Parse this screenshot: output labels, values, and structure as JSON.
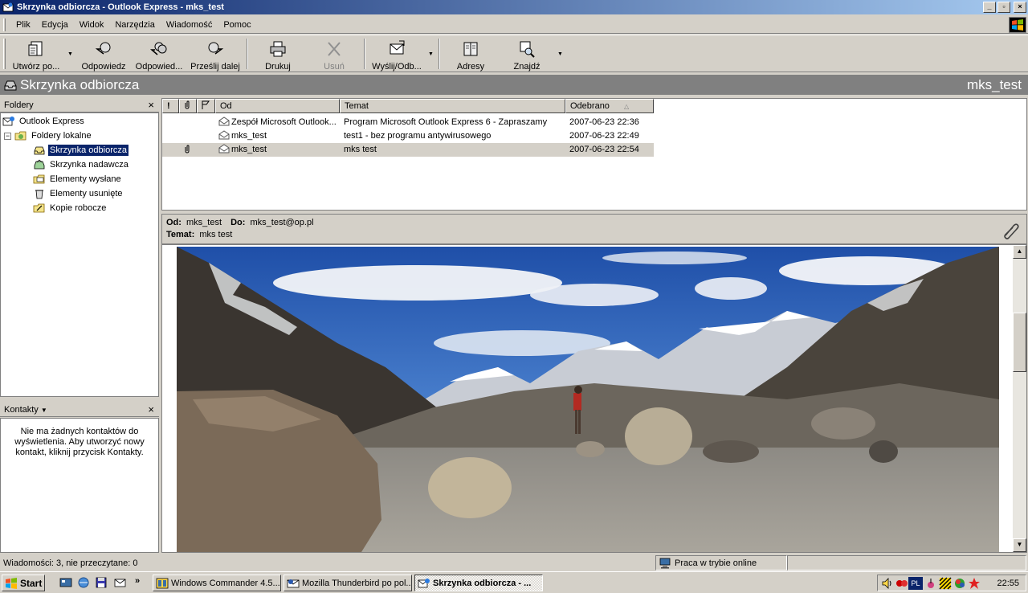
{
  "window": {
    "title": "Skrzynka odbiorcza - Outlook Express - mks_test",
    "minimize_glyph": "_",
    "maximize_glyph": "▫",
    "close_glyph": "×"
  },
  "menu": [
    "Plik",
    "Edycja",
    "Widok",
    "Narzędzia",
    "Wiadomość",
    "Pomoc"
  ],
  "toolbar": {
    "create": "Utwórz po...",
    "reply": "Odpowiedz",
    "reply_all": "Odpowied...",
    "forward": "Prześlij dalej",
    "print": "Drukuj",
    "delete": "Usuń",
    "send_receive": "Wyślij/Odb...",
    "addresses": "Adresy",
    "find": "Znajdź",
    "dropdown_glyph": "▼"
  },
  "folder_bar": {
    "title": "Skrzynka odbiorcza",
    "user": "mks_test"
  },
  "folders": {
    "header": "Foldery",
    "close_glyph": "×",
    "expander": "−",
    "tree": [
      {
        "label": "Outlook Express",
        "icon": "outlook-express-icon"
      },
      {
        "label": "Foldery lokalne",
        "icon": "local-folders-icon"
      },
      {
        "label": "Skrzynka odbiorcza",
        "icon": "inbox-icon"
      },
      {
        "label": "Skrzynka nadawcza",
        "icon": "outbox-icon"
      },
      {
        "label": "Elementy wysłane",
        "icon": "sent-items-icon"
      },
      {
        "label": "Elementy usunięte",
        "icon": "deleted-items-icon"
      },
      {
        "label": "Kopie robocze",
        "icon": "drafts-icon"
      }
    ]
  },
  "contacts": {
    "header": "Kontakty",
    "dropdown_glyph": "▼",
    "close_glyph": "×",
    "message": "Nie ma żadnych kontaktów do wyświetlenia. Aby utworzyć nowy kontakt, kliknij przycisk Kontakty."
  },
  "message_list": {
    "columns": {
      "priority": "!",
      "attachment": "",
      "flag": "",
      "from": "Od",
      "subject": "Temat",
      "received": "Odebrano",
      "sort_glyph": "△"
    },
    "messages": [
      {
        "from": "Zespół Microsoft Outlook...",
        "subject": "Program Microsoft Outlook Express 6 - Zapraszamy",
        "received": "2007-06-23 22:36",
        "attachment": false
      },
      {
        "from": "mks_test",
        "subject": "test1 - bez programu antywirusowego",
        "received": "2007-06-23 22:49",
        "attachment": false
      },
      {
        "from": "mks_test",
        "subject": "mks test",
        "received": "2007-06-23 22:54",
        "attachment": true
      }
    ]
  },
  "preview": {
    "from_label": "Od:",
    "from": "mks_test",
    "to_label": "Do:",
    "to": "mks_test@op.pl",
    "subject_label": "Temat:",
    "subject": "mks test",
    "scroll_up_glyph": "▲",
    "scroll_down_glyph": "▼"
  },
  "status": {
    "messages": "Wiadomości: 3, nie przeczytane: 0",
    "online": "Praca w trybie online"
  },
  "taskbar": {
    "start": "Start",
    "more_glyph": "»",
    "tasks": [
      {
        "label": "Windows Commander 4.5...",
        "active": false
      },
      {
        "label": "Mozilla Thunderbird po pol...",
        "active": false
      },
      {
        "label": "Skrzynka odbiorcza - ...",
        "active": true
      }
    ],
    "lang": "PL",
    "clock": "22:55"
  },
  "colors": {
    "title_gradient_start": "#0a246a",
    "title_gradient_end": "#a6caf0",
    "selection": "#0a246a",
    "face": "#d4d0c8",
    "folder_bar": "#808080"
  }
}
